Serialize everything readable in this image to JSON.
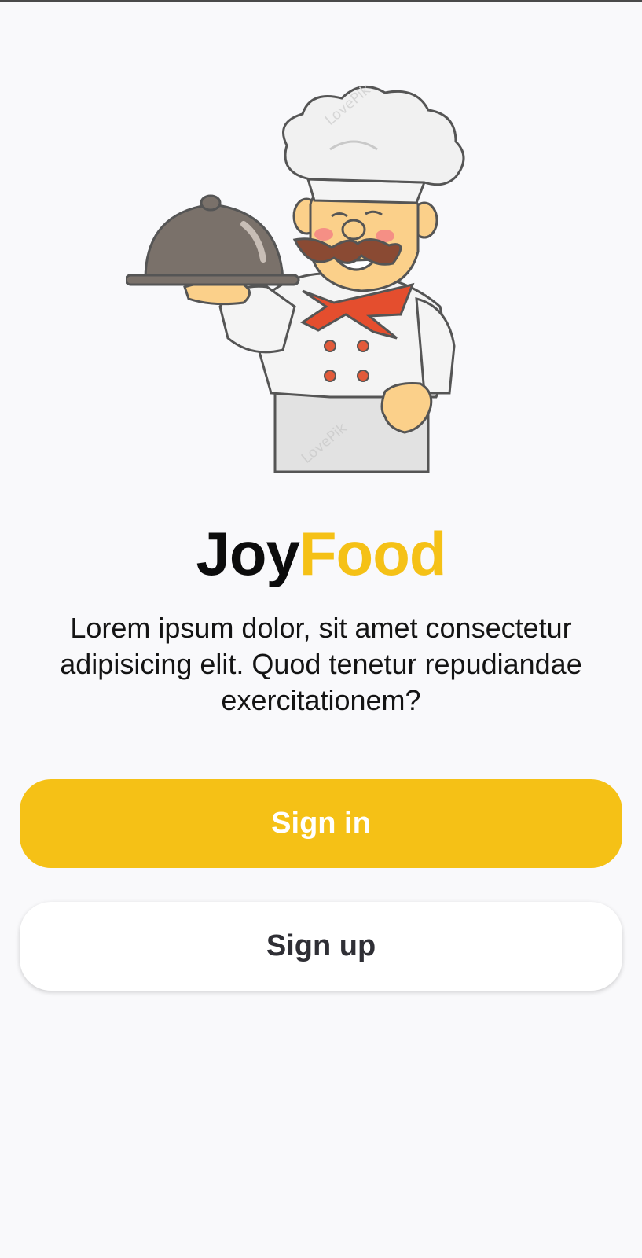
{
  "brand": {
    "part1": "Joy",
    "part2": "Food"
  },
  "tagline": "Lorem ipsum dolor, sit amet consectetur adipisicing elit. Quod tenetur repudiandae exercitationem?",
  "buttons": {
    "signin_label": "Sign in",
    "signup_label": "Sign up"
  },
  "hero": {
    "illustration": "chef-illustration",
    "watermark": "LovePik"
  },
  "colors": {
    "background": "#f9f9fb",
    "accent": "#f5c116",
    "brand_dark": "#0c0c0c",
    "signup_text": "#2f2f35"
  }
}
